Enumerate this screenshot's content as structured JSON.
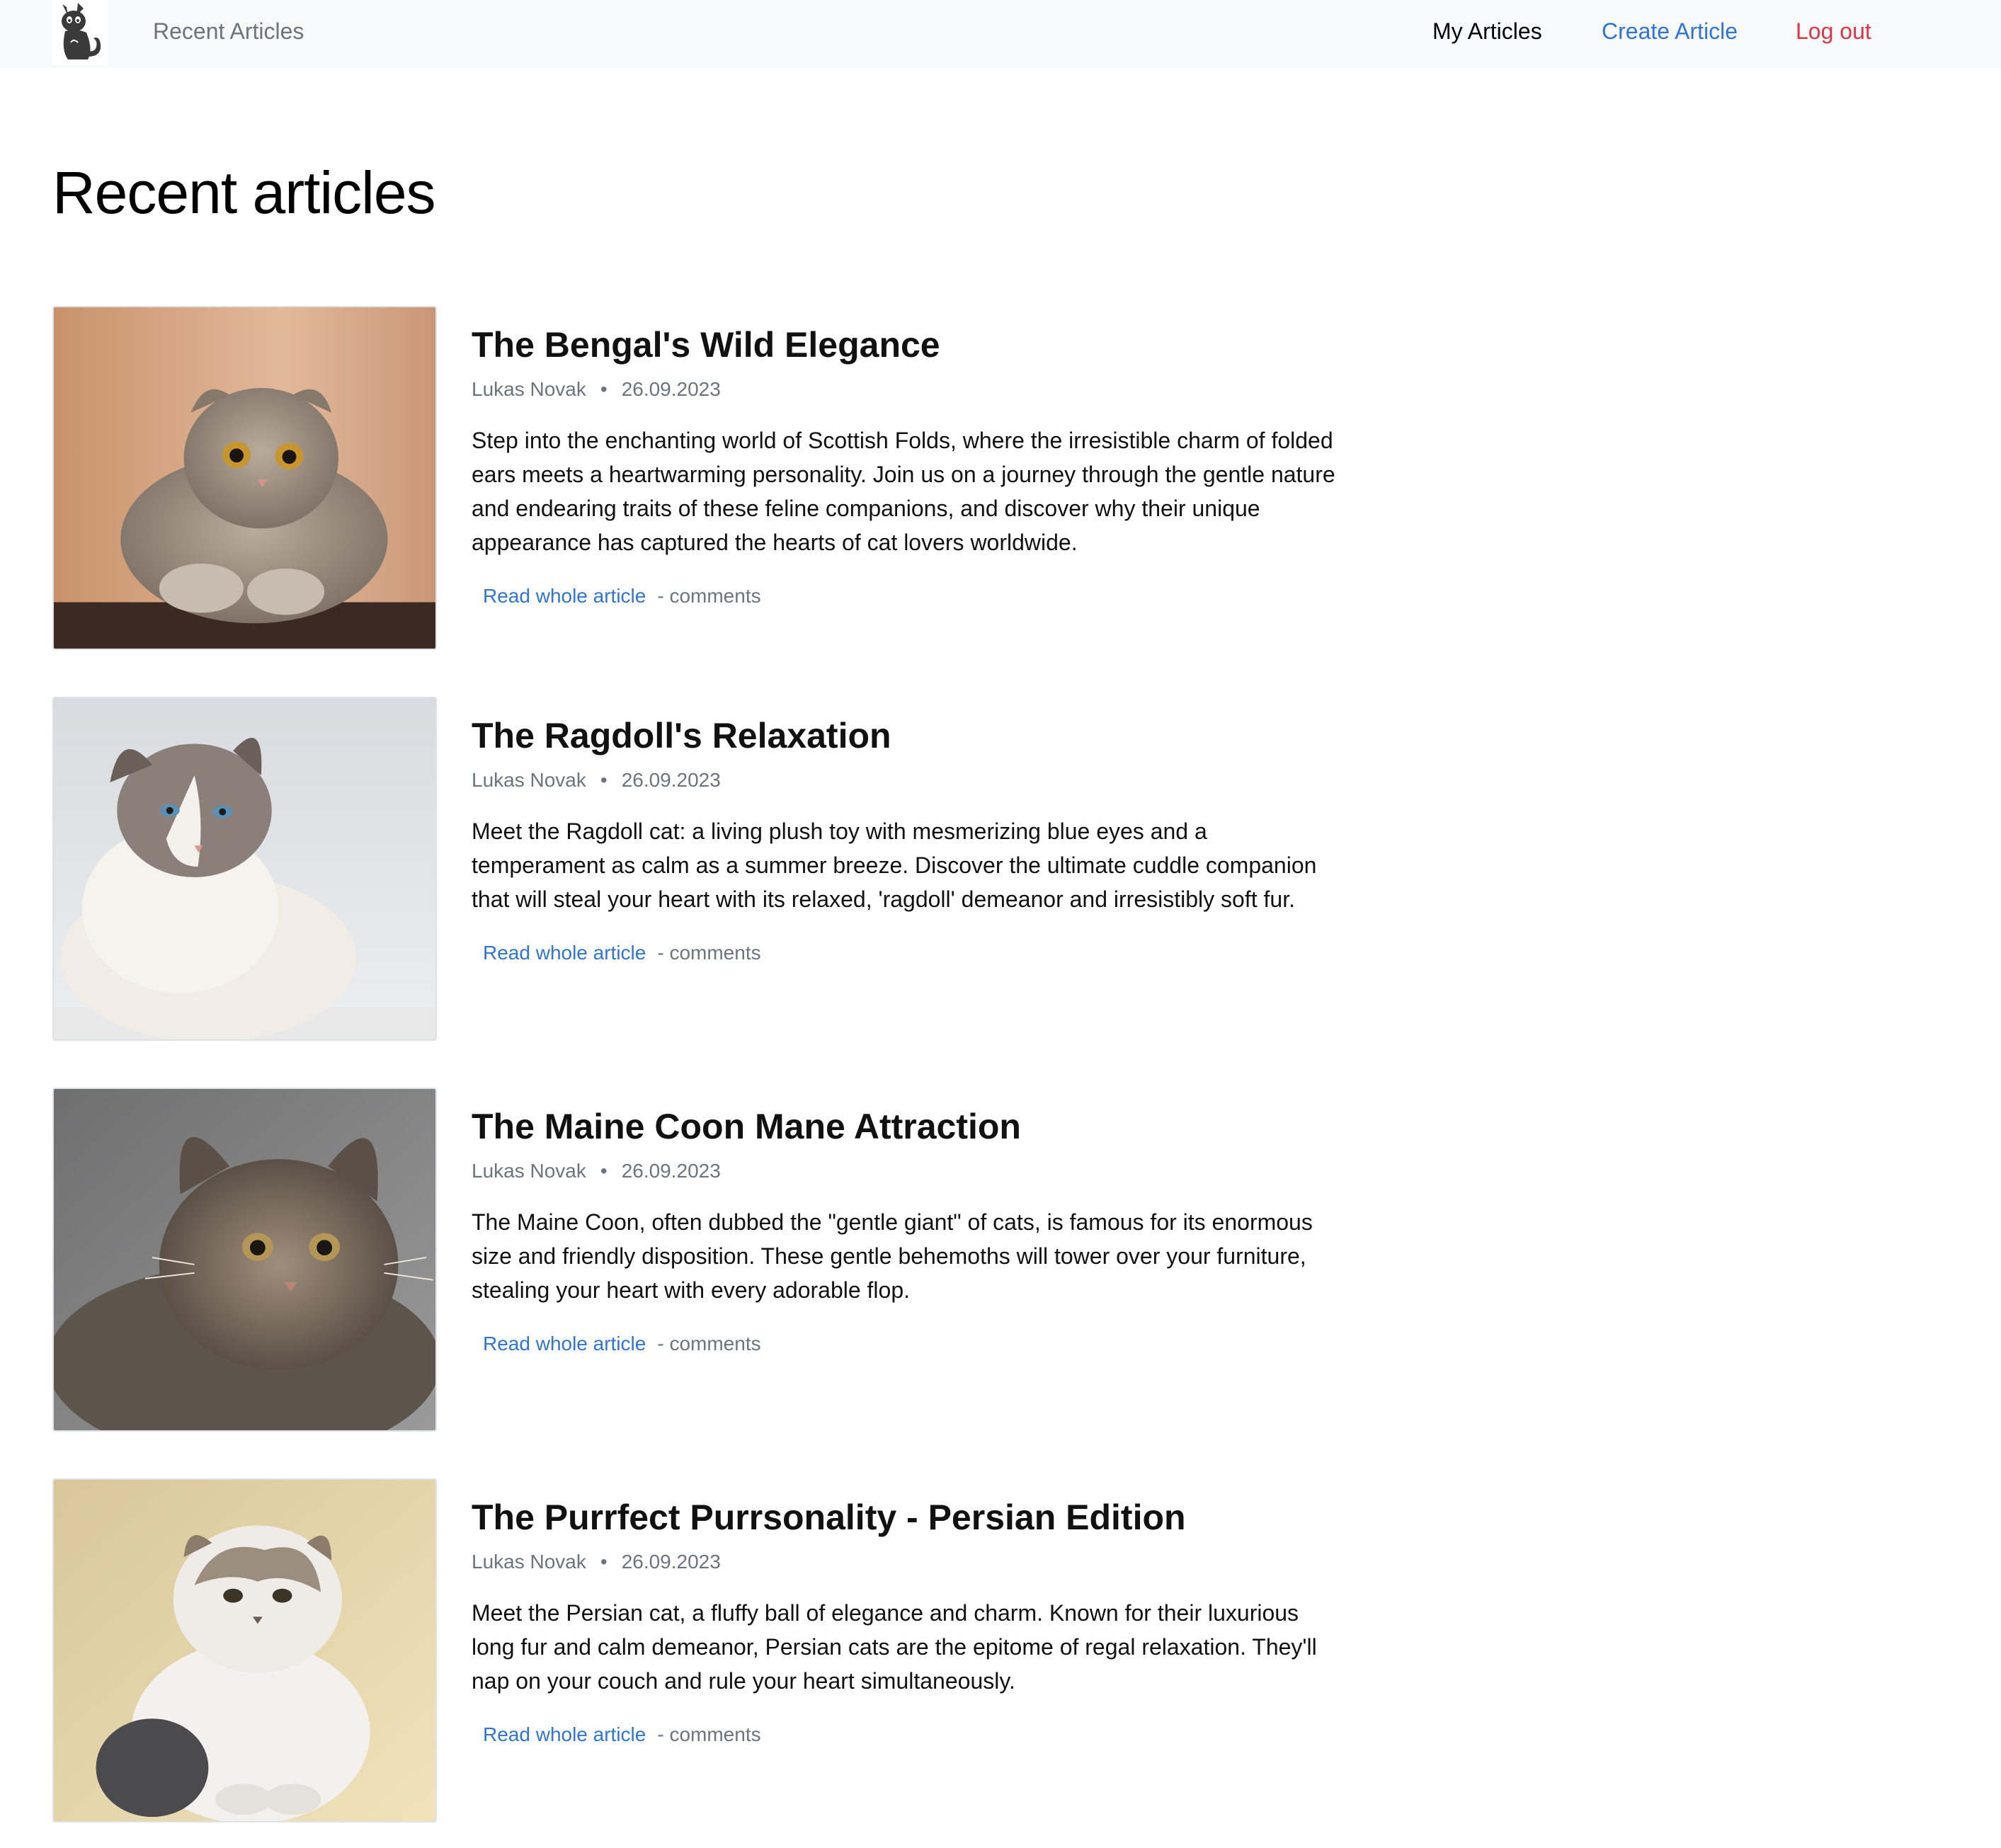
{
  "navbar": {
    "logo": "cat-logo",
    "brand": "Recent Articles",
    "links": {
      "my_articles": "My Articles",
      "create_article": "Create Article",
      "log_out": "Log out"
    },
    "colors": {
      "link": "#2f74d8",
      "danger": "#dc3545",
      "muted": "#6c757d",
      "bar": "#f8f9fa"
    }
  },
  "page": {
    "title": "Recent articles"
  },
  "articles": [
    {
      "title": "The Bengal's Wild Elegance",
      "author": "Lukas Novak",
      "separator": "•",
      "date": "26.09.2023",
      "text": "Step into the enchanting world of Scottish Folds, where the irresistible charm of folded ears meets a heartwarming personality. Join us on a journey through the gentle nature and endearing traits of these feline companions, and discover why their unique appearance has captured the hearts of cat lovers worldwide.",
      "read_label": "Read whole article",
      "comments_label": "- comments",
      "image": "scottish-fold-cat-photo"
    },
    {
      "title": "The Ragdoll's Relaxation",
      "author": "Lukas Novak",
      "separator": "•",
      "date": "26.09.2023",
      "text": "Meet the Ragdoll cat: a living plush toy with mesmerizing blue eyes and a temperament as calm as a summer breeze. Discover the ultimate cuddle companion that will steal your heart with its relaxed, 'ragdoll' demeanor and irresistibly soft fur.",
      "read_label": "Read whole article",
      "comments_label": "- comments",
      "image": "ragdoll-cat-photo"
    },
    {
      "title": "The Maine Coon Mane Attraction",
      "author": "Lukas Novak",
      "separator": "•",
      "date": "26.09.2023",
      "text": "The Maine Coon, often dubbed the \"gentle giant\" of cats, is famous for its enormous size and friendly disposition. These gentle behemoths will tower over your furniture, stealing your heart with every adorable flop.",
      "read_label": "Read whole article",
      "comments_label": "- comments",
      "image": "maine-coon-cat-photo"
    },
    {
      "title": "The Purrfect Purrsonality - Persian Edition",
      "author": "Lukas Novak",
      "separator": "•",
      "date": "26.09.2023",
      "text": "Meet the Persian cat, a fluffy ball of elegance and charm. Known for their luxurious long fur and calm demeanor, Persian cats are the epitome of regal relaxation. They'll nap on your couch and rule your heart simultaneously.",
      "read_label": "Read whole article",
      "comments_label": "- comments",
      "image": "persian-cat-photo"
    }
  ]
}
